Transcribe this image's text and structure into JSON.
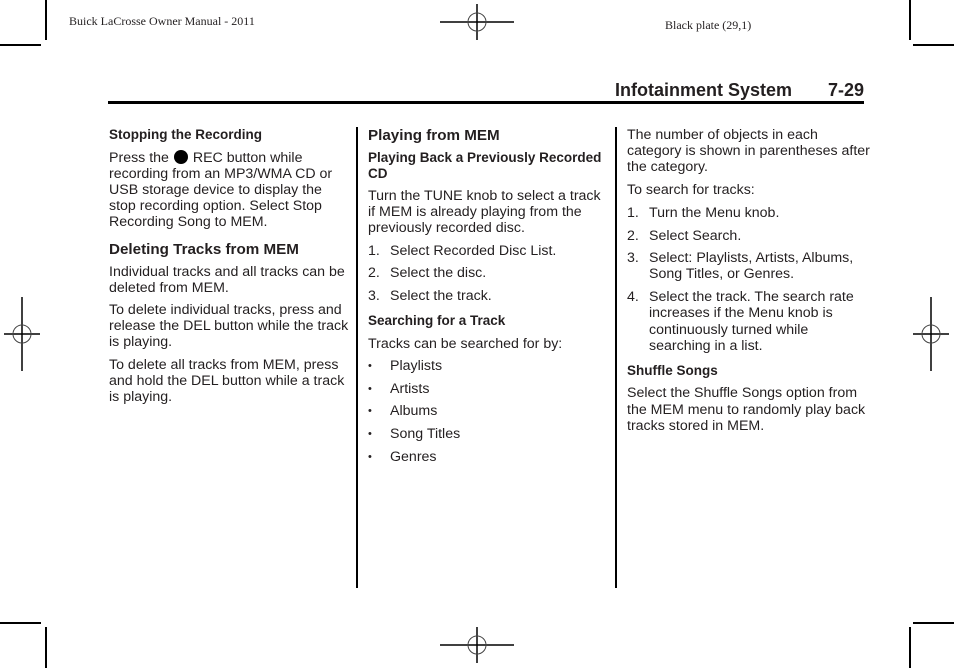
{
  "header": {
    "manual_title": "Buick LaCrosse Owner Manual - 2011",
    "plate": "Black plate (29,1)"
  },
  "page_heading": {
    "section": "Infotainment System",
    "page_number": "7-29"
  },
  "columns": {
    "col1": {
      "stopping": {
        "heading": "Stopping the Recording",
        "text_before_icon": "Press the",
        "icon": "rec-button-icon",
        "text_after_icon": "REC button while recording from an MP3/WMA CD or USB storage device to display the stop recording option. Select Stop Recording Song to MEM."
      },
      "deleting": {
        "heading": "Deleting Tracks from MEM",
        "paragraphs": [
          "Individual tracks and all tracks can be deleted from MEM.",
          "To delete individual tracks, press and release the DEL button while the track is playing.",
          "To delete all tracks from MEM, press and hold the DEL button while a track is playing."
        ]
      }
    },
    "col2": {
      "heading": "Playing from MEM",
      "playing_back": {
        "heading": "Playing Back a Previously Recorded CD",
        "paragraph": "Turn the TUNE knob to select a track if MEM is already playing from the previously recorded disc.",
        "steps": [
          {
            "num": "1.",
            "text": "Select Recorded Disc List."
          },
          {
            "num": "2.",
            "text": "Select the disc."
          },
          {
            "num": "3.",
            "text": "Select the track."
          }
        ]
      },
      "searching": {
        "heading": "Searching for a Track",
        "paragraph": "Tracks can be searched for by:",
        "bullet": "•",
        "items": [
          "Playlists",
          "Artists",
          "Albums",
          "Song Titles",
          "Genres"
        ]
      }
    },
    "col3": {
      "paragraphs": [
        "The number of objects in each category is shown in parentheses after the category.",
        "To search for tracks:"
      ],
      "steps": [
        {
          "num": "1.",
          "text": "Turn the Menu knob."
        },
        {
          "num": "2.",
          "text": "Select Search."
        },
        {
          "num": "3.",
          "text": "Select: Playlists, Artists, Albums, Song Titles, or Genres."
        },
        {
          "num": "4.",
          "text": "Select the track. The search rate increases if the Menu knob is continuously turned while searching in a list."
        }
      ],
      "shuffle": {
        "heading": "Shuffle Songs",
        "paragraph": "Select the Shuffle Songs option from the MEM menu to randomly play back tracks stored in MEM."
      }
    }
  }
}
